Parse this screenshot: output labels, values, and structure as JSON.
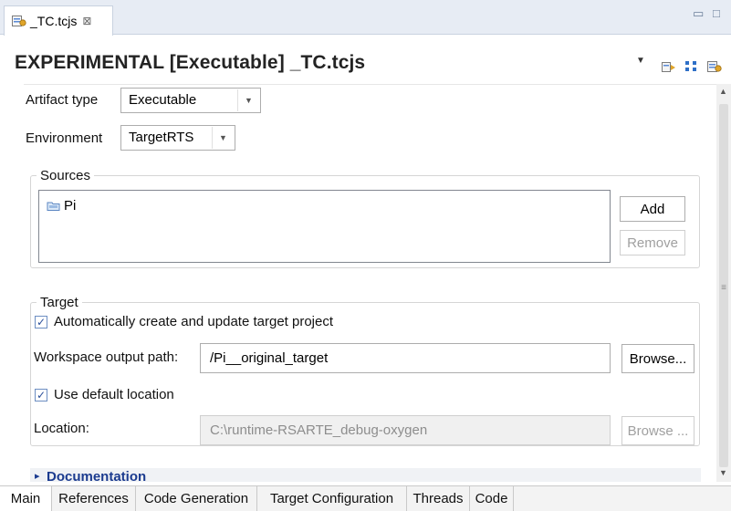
{
  "editor_tab": {
    "label": "_TC.tcjs",
    "close_glyph": "⊠",
    "icon": "tc-file-icon"
  },
  "window_controls": {
    "minimize_glyph": "▭",
    "maximize_glyph": "□"
  },
  "header": {
    "title": "EXPERIMENTAL [Executable] _TC.tcjs",
    "dropdown_glyph": "▼",
    "icons": [
      "build-icon",
      "hierarchy-icon",
      "properties-icon"
    ]
  },
  "form": {
    "artifact_type": {
      "label": "Artifact type",
      "value": "Executable",
      "arrow": "▼"
    },
    "environment": {
      "label": "Environment",
      "value": "TargetRTS",
      "arrow": "▼"
    },
    "sources": {
      "title": "Sources",
      "items": [
        {
          "label": "Pi",
          "icon": "folder-icon"
        }
      ],
      "add_label": "Add",
      "remove_label": "Remove"
    },
    "target": {
      "title": "Target",
      "auto_create": {
        "label": "Automatically create and update target project",
        "checked": true,
        "check_glyph": "✓"
      },
      "workspace_output": {
        "label": "Workspace output path:",
        "value": "/Pi__original_target",
        "browse_label": "Browse..."
      },
      "use_default_location": {
        "label": "Use default location",
        "checked": true,
        "check_glyph": "✓"
      },
      "location": {
        "label": "Location:",
        "value": "C:\\runtime-RSARTE_debug-oxygen",
        "browse_label": "Browse ..."
      }
    },
    "documentation": {
      "label": "Documentation",
      "expander": "▸"
    }
  },
  "scrollbar": {
    "up": "▲",
    "down": "▼",
    "grip": "≡"
  },
  "bottom_tabs": [
    {
      "label": "Main",
      "active": true
    },
    {
      "label": "References",
      "active": false
    },
    {
      "label": "Code Generation",
      "active": false
    },
    {
      "label": "Target Configuration",
      "active": false
    },
    {
      "label": "Threads",
      "active": false
    },
    {
      "label": "Code",
      "active": false
    }
  ],
  "colors": {
    "tabbar_bg": "#e7ecf4",
    "doc_link": "#1b3b8f",
    "check": "#2a4f9a"
  }
}
